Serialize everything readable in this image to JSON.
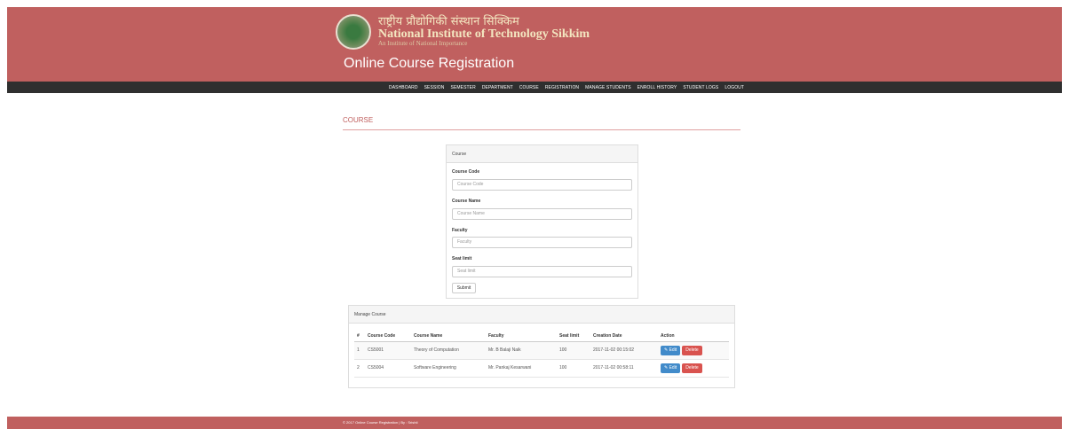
{
  "header": {
    "institute_hindi": "राष्ट्रीय प्रौद्योगिकी संस्थान सिक्किम",
    "institute_english": "National Institute of Technology Sikkim",
    "institute_sub": "An Institute of National Importance",
    "app_title": "Online Course Registration",
    "colors": {
      "header_bg": "#c0605f",
      "nav_bg": "#2f2f2f"
    }
  },
  "nav": {
    "items": [
      "DASHBOARD",
      "SESSION",
      "SEMESTER",
      "DEPARTMENT",
      "COURSE",
      "REGISTRATION",
      "MANAGE STUDENTS",
      "ENROLL HISTORY",
      "STUDENT LOGS",
      "LOGOUT"
    ]
  },
  "page": {
    "title": "COURSE"
  },
  "course_form": {
    "panel_title": "Course",
    "fields": [
      {
        "label": "Course Code",
        "placeholder": "Course Code",
        "value": ""
      },
      {
        "label": "Course Name",
        "placeholder": "Course Name",
        "value": ""
      },
      {
        "label": "Faculty",
        "placeholder": "Faculty",
        "value": ""
      },
      {
        "label": "Seat limit",
        "placeholder": "Seat limit",
        "value": ""
      }
    ],
    "submit_label": "Submit"
  },
  "manage": {
    "panel_title": "Manage Course",
    "columns": [
      "#",
      "Course Code",
      "Course Name",
      "Faculty",
      "Seat limit",
      "Creation Date",
      "Action"
    ],
    "rows": [
      {
        "num": "1",
        "code": "CS5001",
        "name": "Theory of Computation",
        "faculty": "Mr. B Balaji Naik",
        "seats": "100",
        "date": "2017-11-02 00:15:02",
        "edit": "Edit",
        "delete": "Delete"
      },
      {
        "num": "2",
        "code": "CS5004",
        "name": "Software Engineering",
        "faculty": "Mr. Pankaj Kesarwani",
        "seats": "100",
        "date": "2017-11-02 00:58:11",
        "edit": "Edit",
        "delete": "Delete"
      }
    ],
    "colors": {
      "edit": "#428bca",
      "delete": "#d9534f"
    }
  },
  "footer": {
    "text": "© 2017 Online Course Registration | By : Srishti"
  }
}
